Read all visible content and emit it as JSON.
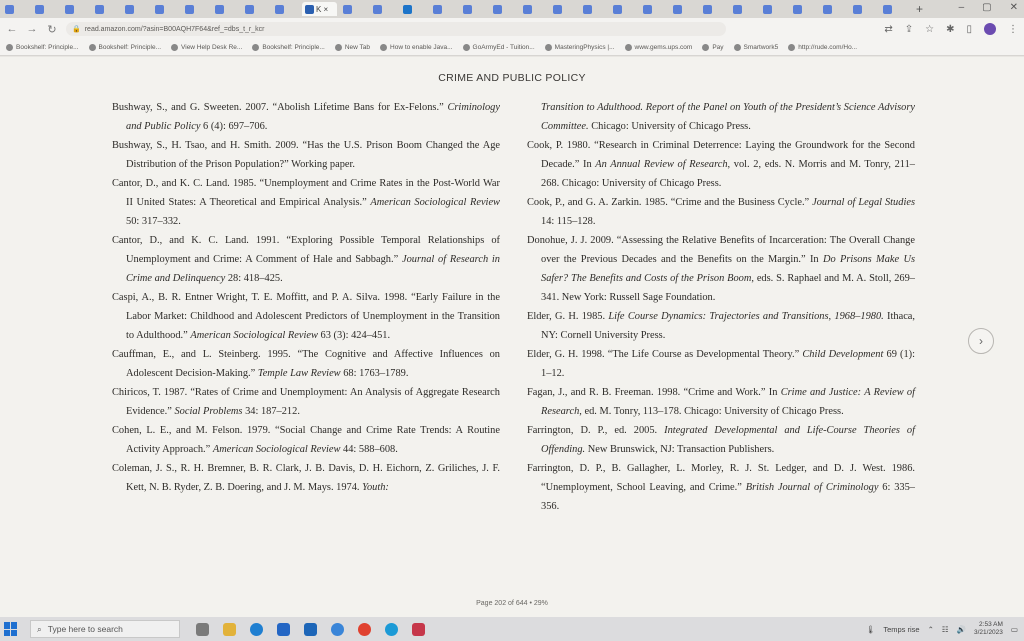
{
  "browser": {
    "tabs": [
      {
        "label": "",
        "color": "#5a7fd6"
      },
      {
        "label": "",
        "color": "#5a7fd6"
      },
      {
        "label": "",
        "color": "#5a7fd6"
      },
      {
        "label": "",
        "color": "#5a7fd6"
      },
      {
        "label": "",
        "color": "#5a7fd6"
      },
      {
        "label": "",
        "color": "#5a7fd6"
      },
      {
        "label": "",
        "color": "#5a7fd6"
      },
      {
        "label": "",
        "color": "#5a7fd6"
      },
      {
        "label": "",
        "color": "#5a7fd6"
      },
      {
        "label": "",
        "color": "#5a7fd6"
      },
      {
        "label": "K ×",
        "color": "#2a5fb0",
        "active": true
      },
      {
        "label": "",
        "color": "#5a7fd6"
      },
      {
        "label": "",
        "color": "#5a7fd6"
      },
      {
        "label": "",
        "color": "#1d74c9"
      },
      {
        "label": "",
        "color": "#5a7fd6"
      },
      {
        "label": "",
        "color": "#5a7fd6"
      },
      {
        "label": "",
        "color": "#5a7fd6"
      },
      {
        "label": "",
        "color": "#5a7fd6"
      },
      {
        "label": "",
        "color": "#5a7fd6"
      },
      {
        "label": "",
        "color": "#5a7fd6"
      },
      {
        "label": "",
        "color": "#5a7fd6"
      },
      {
        "label": "",
        "color": "#5a7fd6"
      },
      {
        "label": "",
        "color": "#5a7fd6"
      },
      {
        "label": "",
        "color": "#5a7fd6"
      },
      {
        "label": "",
        "color": "#5a7fd6"
      },
      {
        "label": "",
        "color": "#5a7fd6"
      },
      {
        "label": "",
        "color": "#5a7fd6"
      },
      {
        "label": "",
        "color": "#5a7fd6"
      },
      {
        "label": "",
        "color": "#5a7fd6"
      },
      {
        "label": "",
        "color": "#5a7fd6"
      }
    ],
    "new_tab": "+",
    "url": "read.amazon.com/?asin=B00AQH7F64&ref_=dbs_t_r_kcr",
    "bookmarks": [
      "Bookshelf: Principle...",
      "Bookshelf: Principle...",
      "View Help Desk Re...",
      "Bookshelf: Principle...",
      "New Tab",
      "How to enable Java...",
      "GoArmyEd - Tuition...",
      "MasteringPhysics |...",
      "www.gems.ups.com",
      "Pay",
      "Smartwork5",
      "http://rude.com/Ho..."
    ]
  },
  "reader": {
    "running_head": "CRIME AND PUBLIC POLICY",
    "page_info": "Page 202 of 644 • 29%",
    "next_label": "›"
  },
  "taskbar": {
    "search_placeholder": "Type here to search",
    "weather": "Temps rise",
    "time": "2:53 AM",
    "date": "3/21/2023"
  }
}
